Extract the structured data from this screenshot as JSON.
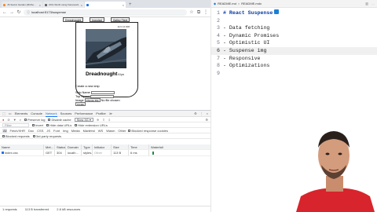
{
  "browser": {
    "tabs": [
      {
        "title": "JS Secret Garden (MicSo..."
      },
      {
        "title": "UKG Worth using framework..."
      },
      {
        "title": ""
      }
    ],
    "address": "localhost:5173/suspense"
  },
  "app": {
    "nav": [
      "Dreadnought",
      "Ironclad",
      "Galley Fleet"
    ],
    "card": {
      "date": "11/4 12:008",
      "name": "Dreadnought",
      "tonnage": "6 lyn"
    },
    "form": {
      "title": "Create a new ship",
      "name_label": "Ship Name",
      "speed_label": "Top Speed",
      "image_label": "Image",
      "choose_file": "Choose File",
      "no_file": "No file chosen",
      "create": "Create"
    }
  },
  "devtools": {
    "tabs": [
      "Elements",
      "Console",
      "Network",
      "Sources",
      "Performance",
      "Profiler"
    ],
    "active_tab": "Network",
    "more_tabs": "≫",
    "toolbar": {
      "preserve_log": "Preserve log",
      "disable_cache": "Disable cache",
      "throttle": "Slow 3G"
    },
    "filter": {
      "placeholder": "Filter",
      "invert": "Invert",
      "hide_data_urls": "Hide data URLs",
      "hide_ext_urls": "Hide extension URLs"
    },
    "types": [
      "All",
      "Fetch/XHR",
      "Doc",
      "CSS",
      "JS",
      "Font",
      "Img",
      "Media",
      "Manifest",
      "WS",
      "Wasm",
      "Other"
    ],
    "blocked": {
      "response_cookies": "Blocked response cookies",
      "requests": "Blocked requests",
      "third_party": "3rd-party requests"
    },
    "columns": [
      "Name",
      "Met...",
      "Status",
      "Domain",
      "Type",
      "Initiator",
      "Size",
      "Time",
      "Waterfall"
    ],
    "rows": [
      {
        "name": "index.css",
        "method": "GET",
        "status": "304",
        "domain": "localh...",
        "type": "styles...",
        "initiator": "Other",
        "size": "113 B",
        "time": "6 ms"
      }
    ],
    "status_bar": [
      "1 requests",
      "113 B transferred",
      "2.8 kB resources"
    ]
  },
  "editor": {
    "tabs": [
      {
        "title": "README.md"
      },
      {
        "title": "README.mdx"
      }
    ],
    "lines": [
      "# React Suspense",
      "",
      "- Data fetching",
      "- Dynamic Promises",
      "- Optimistic UI",
      "- Suspense img",
      "- Responsive",
      "- Optimizations",
      ""
    ],
    "current_line": 6
  }
}
